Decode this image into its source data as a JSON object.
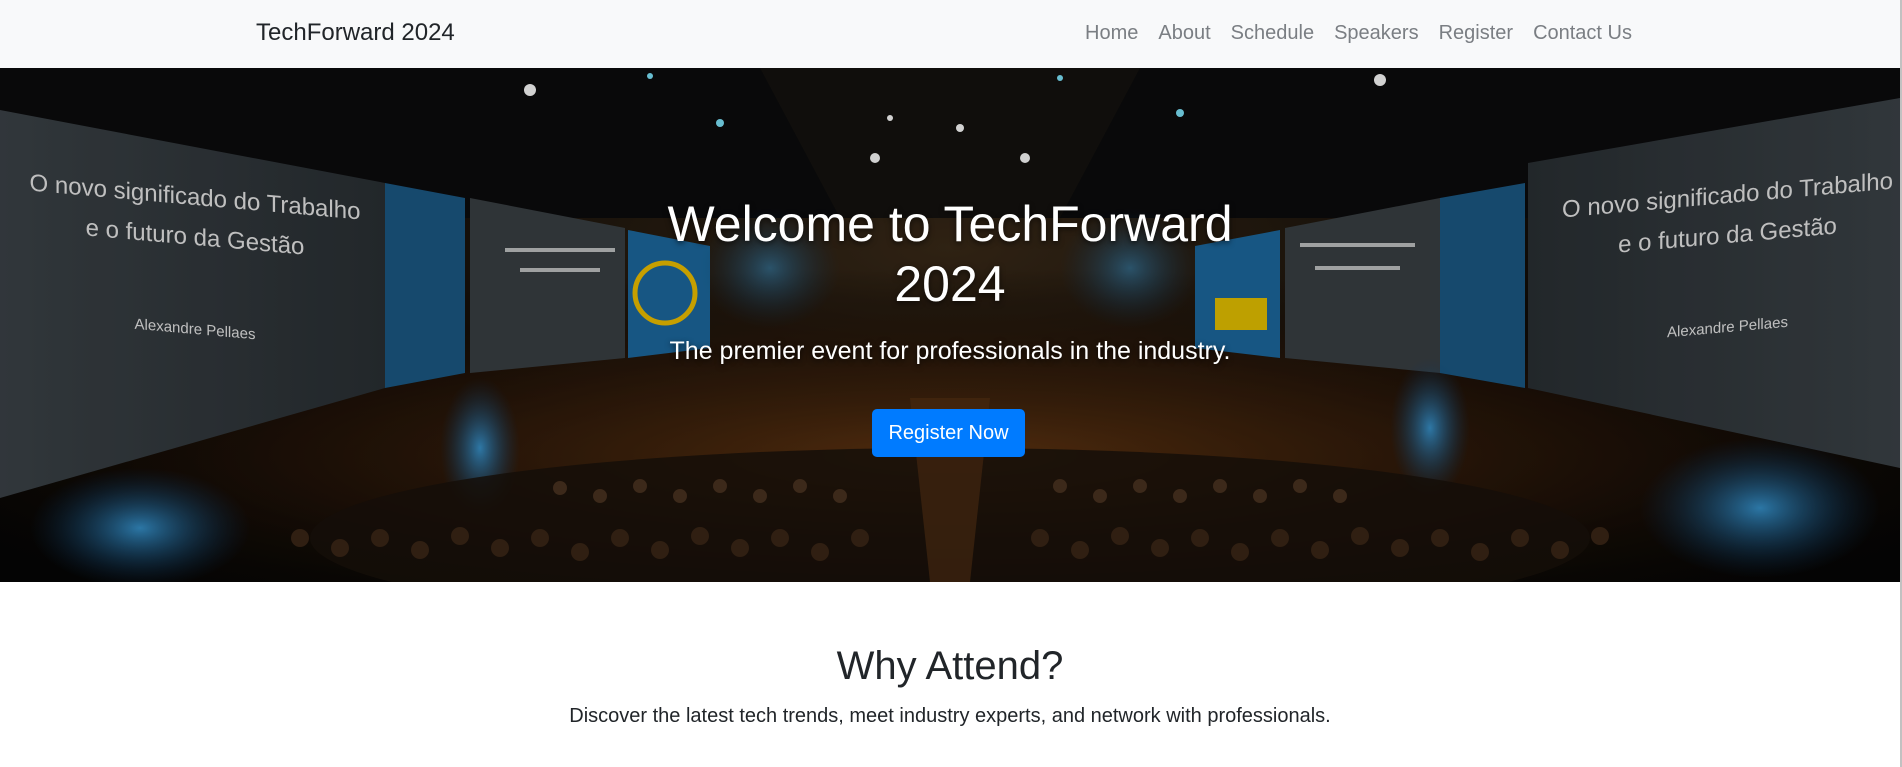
{
  "navbar": {
    "brand": "TechForward 2024",
    "links": [
      "Home",
      "About",
      "Schedule",
      "Speakers",
      "Register",
      "Contact Us"
    ]
  },
  "hero": {
    "title": "Welcome to TechForward 2024",
    "subtitle": "The premier event for professionals in the industry.",
    "button_label": "Register Now",
    "image": {
      "left_screen_line1": "O novo significado do Trabalho",
      "left_screen_line2": "e o futuro da Gestão",
      "left_screen_presenter": "Alexandre Pellaes",
      "right_screen_line1": "O novo significado do Trabalho",
      "right_screen_line2": "e o futuro da Gestão",
      "right_screen_presenter": "Alexandre Pellaes"
    }
  },
  "why_attend": {
    "title": "Why Attend?",
    "text": "Discover the latest tech trends, meet industry experts, and network with professionals."
  },
  "colors": {
    "navbar_bg": "#f8f9fa",
    "nav_link": "#7a7e83",
    "button": "#007bff",
    "text_dark": "#212529"
  }
}
